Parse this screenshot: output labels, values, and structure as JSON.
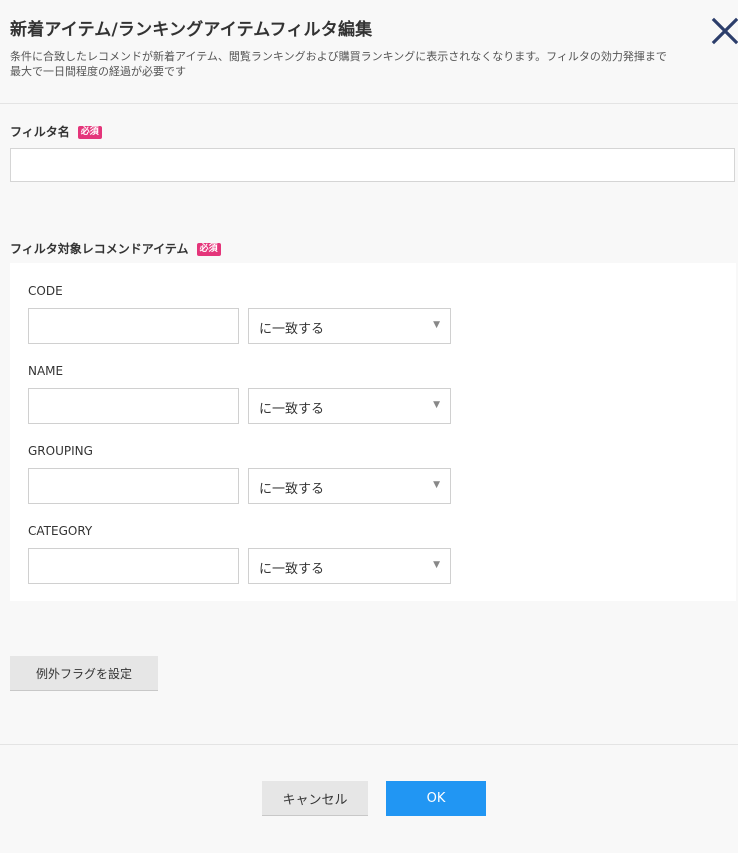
{
  "dialog": {
    "title": "新着アイテム/ランキングアイテムフィルタ編集",
    "description_line1": "条件に合致したレコメンドが新着アイテム、閲覧ランキングおよび購買ランキングに表示されなくなります。フィルタの効力発揮まで",
    "description_line2": "最大で一日間程度の経過が必要です",
    "close_icon": "close-icon",
    "accent_color": "#2196f3",
    "required_badge_color": "#e4357a"
  },
  "filter_name": {
    "label": "フィルタ名",
    "required_badge": "必須",
    "value": ""
  },
  "filter_items": {
    "label": "フィルタ対象レコメンドアイテム",
    "required_badge": "必須",
    "items": [
      {
        "label": "CODE",
        "value": "",
        "match": "に一致する"
      },
      {
        "label": "NAME",
        "value": "",
        "match": "に一致する"
      },
      {
        "label": "GROUPING",
        "value": "",
        "match": "に一致する"
      },
      {
        "label": "CATEGORY",
        "value": "",
        "match": "に一致する"
      }
    ]
  },
  "exception_button": "例外フラグを設定",
  "footer": {
    "cancel": "キャンセル",
    "ok": "OK"
  }
}
